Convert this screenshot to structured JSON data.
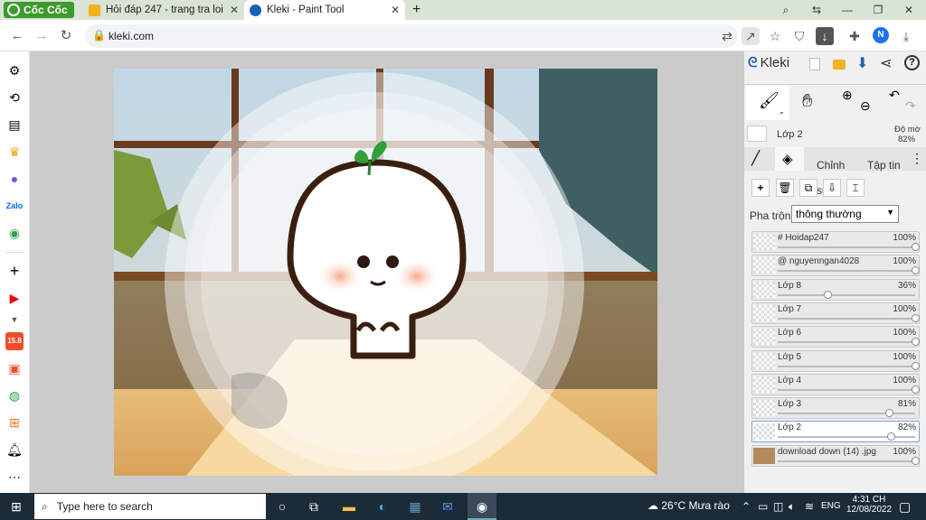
{
  "browser": {
    "brand": "Cốc Cốc",
    "tabs": [
      {
        "title": "Hỏi đáp 247 - trang tra loi",
        "active": false
      },
      {
        "title": "Kleki - Paint Tool",
        "active": true
      }
    ],
    "url": "kleki.com",
    "profile_initial": "N"
  },
  "sidebar": {
    "icons": [
      "settings-icon",
      "history-icon",
      "reading-list-icon",
      "crown-icon",
      "messenger-icon",
      "zalo-icon",
      "gamepad-icon",
      "add-icon",
      "youtube-icon",
      "chevron-down-icon",
      "shopee-icon",
      "gift-icon",
      "map-icon",
      "tiki-icon",
      "notification-icon",
      "more-icon"
    ],
    "badge": "15.8"
  },
  "kleki": {
    "logo": "Kleki",
    "selected_layer": "Lớp 2",
    "opacity_label": "Độ mờ",
    "opacity_value": "82%",
    "tabs": [
      "Chỉnh sửa",
      "Tập tin"
    ],
    "blend_label": "Pha trộn",
    "blend_value": "thông thường",
    "layers": [
      {
        "name": "# Hoidap247",
        "opacity": "100%",
        "value": 1.0,
        "selected": false
      },
      {
        "name": "@ nguyenngan4028",
        "opacity": "100%",
        "value": 1.0,
        "selected": false
      },
      {
        "name": "Lớp 8",
        "opacity": "36%",
        "value": 0.36,
        "selected": false
      },
      {
        "name": "Lớp 7",
        "opacity": "100%",
        "value": 1.0,
        "selected": false
      },
      {
        "name": "Lớp 6",
        "opacity": "100%",
        "value": 1.0,
        "selected": false
      },
      {
        "name": "Lớp 5",
        "opacity": "100%",
        "value": 1.0,
        "selected": false
      },
      {
        "name": "Lớp 4",
        "opacity": "100%",
        "value": 1.0,
        "selected": false
      },
      {
        "name": "Lớp 3",
        "opacity": "81%",
        "value": 0.81,
        "selected": false
      },
      {
        "name": "Lớp 2",
        "opacity": "82%",
        "value": 0.82,
        "selected": true
      },
      {
        "name": "download down (14) .jpg",
        "opacity": "100%",
        "value": 1.0,
        "selected": false
      }
    ]
  },
  "taskbar": {
    "search_placeholder": "Type here to search",
    "weather": "26°C  Mưa rào",
    "lang": "ENG",
    "time": "4:31 CH",
    "date": "12/08/2022"
  },
  "colors": {
    "accent": "#1a73e8",
    "brand_green": "#3c9b2d",
    "taskbar": "#1c2b38"
  }
}
